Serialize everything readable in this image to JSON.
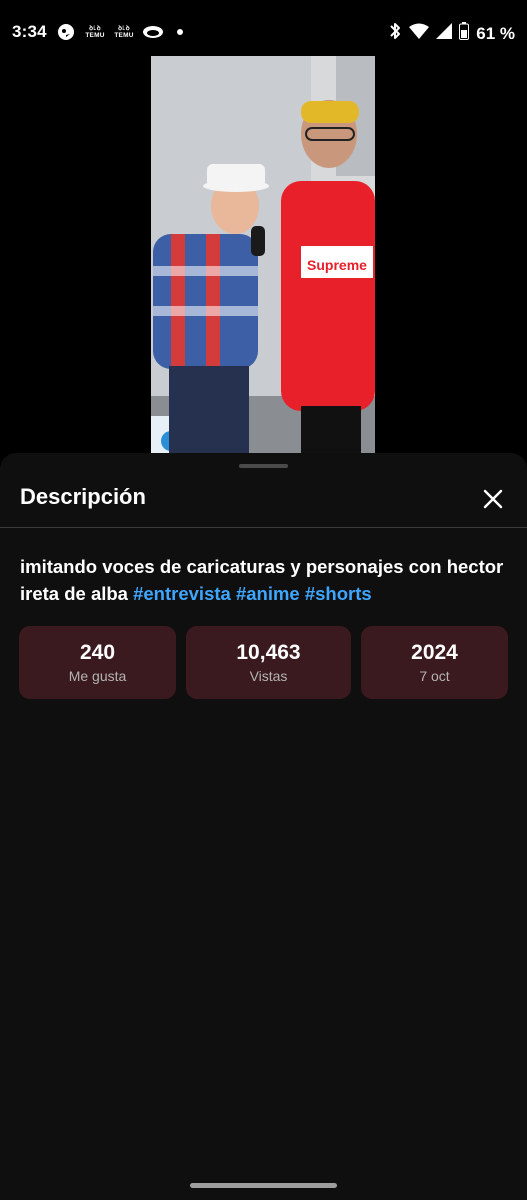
{
  "status_bar": {
    "time": "3:34",
    "notifications": [
      "bird-app-icon",
      "temu-icon",
      "temu-icon",
      "eye-app-icon",
      "dot-icon"
    ],
    "temu_label_top": "ꝺ꜖ꝺ",
    "temu_label_bottom": "TEMU",
    "battery_percent": "61 %"
  },
  "video": {
    "shirt_text": "Supreme"
  },
  "sheet": {
    "title": "Descripción",
    "description_text": "imitando voces de caricaturas y personajes con hector ireta de alba ",
    "hashtags": [
      "#entrevista",
      "#anime",
      "#shorts"
    ],
    "stats": [
      {
        "value": "240",
        "label": "Me gusta"
      },
      {
        "value": "10,463",
        "label": "Vistas"
      },
      {
        "value": "2024",
        "label": "7 oct"
      }
    ]
  },
  "colors": {
    "background": "#0f0f0f",
    "card": "#3b1a1f",
    "hashtag": "#3ea6ff",
    "shirt_red": "#e8202a"
  }
}
